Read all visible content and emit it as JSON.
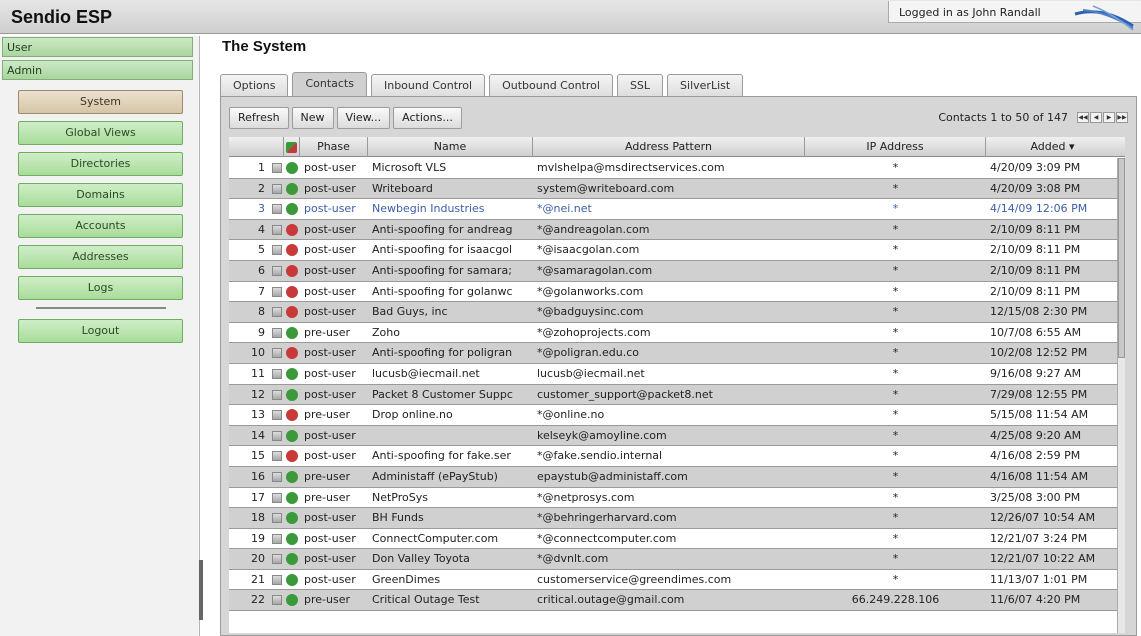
{
  "app": {
    "title": "Sendio ESP",
    "logged_in": "Logged in as John Randall"
  },
  "sidebar": {
    "sections": [
      "User",
      "Admin"
    ],
    "items": [
      "System",
      "Global Views",
      "Directories",
      "Domains",
      "Accounts",
      "Addresses",
      "Logs"
    ],
    "logout": "Logout",
    "active": "System"
  },
  "page": {
    "title": "The System"
  },
  "tabs": [
    "Options",
    "Contacts",
    "Inbound Control",
    "Outbound Control",
    "SSL",
    "SilverList"
  ],
  "active_tab": "Contacts",
  "toolbar": {
    "refresh": "Refresh",
    "new": "New",
    "view": "View...",
    "actions": "Actions..."
  },
  "pager": {
    "text": "Contacts 1 to 50 of 147"
  },
  "columns": [
    "",
    "",
    "",
    "Phase",
    "Name",
    "Address Pattern",
    "IP Address",
    "Added ▾"
  ],
  "colors": {
    "green": "#3a9a3a",
    "red": "#c83a3a",
    "select": "#3a5fa8"
  },
  "rows": [
    {
      "n": "1",
      "status": "green",
      "phase": "post-user",
      "name": "Microsoft VLS",
      "addr": "mvlshelpa@msdirectservices.com",
      "ip": "*",
      "added": "4/20/09 3:09 PM"
    },
    {
      "n": "2",
      "status": "green",
      "phase": "post-user",
      "name": "Writeboard",
      "addr": "system@writeboard.com",
      "ip": "*",
      "added": "4/20/09 3:08 PM"
    },
    {
      "n": "3",
      "status": "green",
      "phase": "post-user",
      "name": "Newbegin Industries",
      "addr": "*@nei.net",
      "ip": "*",
      "added": "4/14/09 12:06 PM",
      "selected": true
    },
    {
      "n": "4",
      "status": "red",
      "phase": "post-user",
      "name": "Anti-spoofing for andreag",
      "addr": "*@andreagolan.com",
      "ip": "*",
      "added": "2/10/09 8:11 PM"
    },
    {
      "n": "5",
      "status": "red",
      "phase": "post-user",
      "name": "Anti-spoofing for isaacgol",
      "addr": "*@isaacgolan.com",
      "ip": "*",
      "added": "2/10/09 8:11 PM"
    },
    {
      "n": "6",
      "status": "red",
      "phase": "post-user",
      "name": "Anti-spoofing for samara;",
      "addr": "*@samaragolan.com",
      "ip": "*",
      "added": "2/10/09 8:11 PM"
    },
    {
      "n": "7",
      "status": "red",
      "phase": "post-user",
      "name": "Anti-spoofing for golanwc",
      "addr": "*@golanworks.com",
      "ip": "*",
      "added": "2/10/09 8:11 PM"
    },
    {
      "n": "8",
      "status": "red",
      "phase": "post-user",
      "name": "Bad Guys, inc",
      "addr": "*@badguysinc.com",
      "ip": "*",
      "added": "12/15/08 2:30 PM"
    },
    {
      "n": "9",
      "status": "green",
      "phase": "pre-user",
      "name": "Zoho",
      "addr": "*@zohoprojects.com",
      "ip": "*",
      "added": "10/7/08 6:55 AM"
    },
    {
      "n": "10",
      "status": "red",
      "phase": "post-user",
      "name": "Anti-spoofing for poligran",
      "addr": "*@poligran.edu.co",
      "ip": "*",
      "added": "10/2/08 12:52 PM"
    },
    {
      "n": "11",
      "status": "green",
      "phase": "post-user",
      "name": "lucusb@iecmail.net",
      "addr": "lucusb@iecmail.net",
      "ip": "*",
      "added": "9/16/08 9:27 AM"
    },
    {
      "n": "12",
      "status": "green",
      "phase": "post-user",
      "name": "Packet 8 Customer Suppc",
      "addr": "customer_support@packet8.net",
      "ip": "*",
      "added": "7/29/08 12:55 PM"
    },
    {
      "n": "13",
      "status": "red",
      "phase": "pre-user",
      "name": "Drop online.no",
      "addr": "*@online.no",
      "ip": "*",
      "added": "5/15/08 11:54 AM"
    },
    {
      "n": "14",
      "status": "green",
      "phase": "post-user",
      "name": "",
      "addr": "kelseyk@amoyline.com",
      "ip": "*",
      "added": "4/25/08 9:20 AM"
    },
    {
      "n": "15",
      "status": "red",
      "phase": "post-user",
      "name": "Anti-spoofing for fake.ser",
      "addr": "*@fake.sendio.internal",
      "ip": "*",
      "added": "4/16/08 2:59 PM"
    },
    {
      "n": "16",
      "status": "green",
      "phase": "pre-user",
      "name": "Administaff (ePayStub)",
      "addr": "epaystub@administaff.com",
      "ip": "*",
      "added": "4/16/08 11:54 AM"
    },
    {
      "n": "17",
      "status": "green",
      "phase": "pre-user",
      "name": "NetProSys",
      "addr": "*@netprosys.com",
      "ip": "*",
      "added": "3/25/08 3:00 PM"
    },
    {
      "n": "18",
      "status": "green",
      "phase": "post-user",
      "name": "BH Funds",
      "addr": "*@behringerharvard.com",
      "ip": "*",
      "added": "12/26/07 10:54 AM"
    },
    {
      "n": "19",
      "status": "green",
      "phase": "post-user",
      "name": "ConnectComputer.com",
      "addr": "*@connectcomputer.com",
      "ip": "*",
      "added": "12/21/07 3:24 PM"
    },
    {
      "n": "20",
      "status": "green",
      "phase": "post-user",
      "name": "Don Valley Toyota",
      "addr": "*@dvnlt.com",
      "ip": "*",
      "added": "12/21/07 10:22 AM"
    },
    {
      "n": "21",
      "status": "green",
      "phase": "post-user",
      "name": "GreenDimes",
      "addr": "customerservice@greendimes.com",
      "ip": "*",
      "added": "11/13/07 1:01 PM"
    },
    {
      "n": "22",
      "status": "green",
      "phase": "pre-user",
      "name": "Critical Outage Test",
      "addr": "critical.outage@gmail.com",
      "ip": "66.249.228.106",
      "added": "11/6/07 4:20 PM"
    }
  ]
}
